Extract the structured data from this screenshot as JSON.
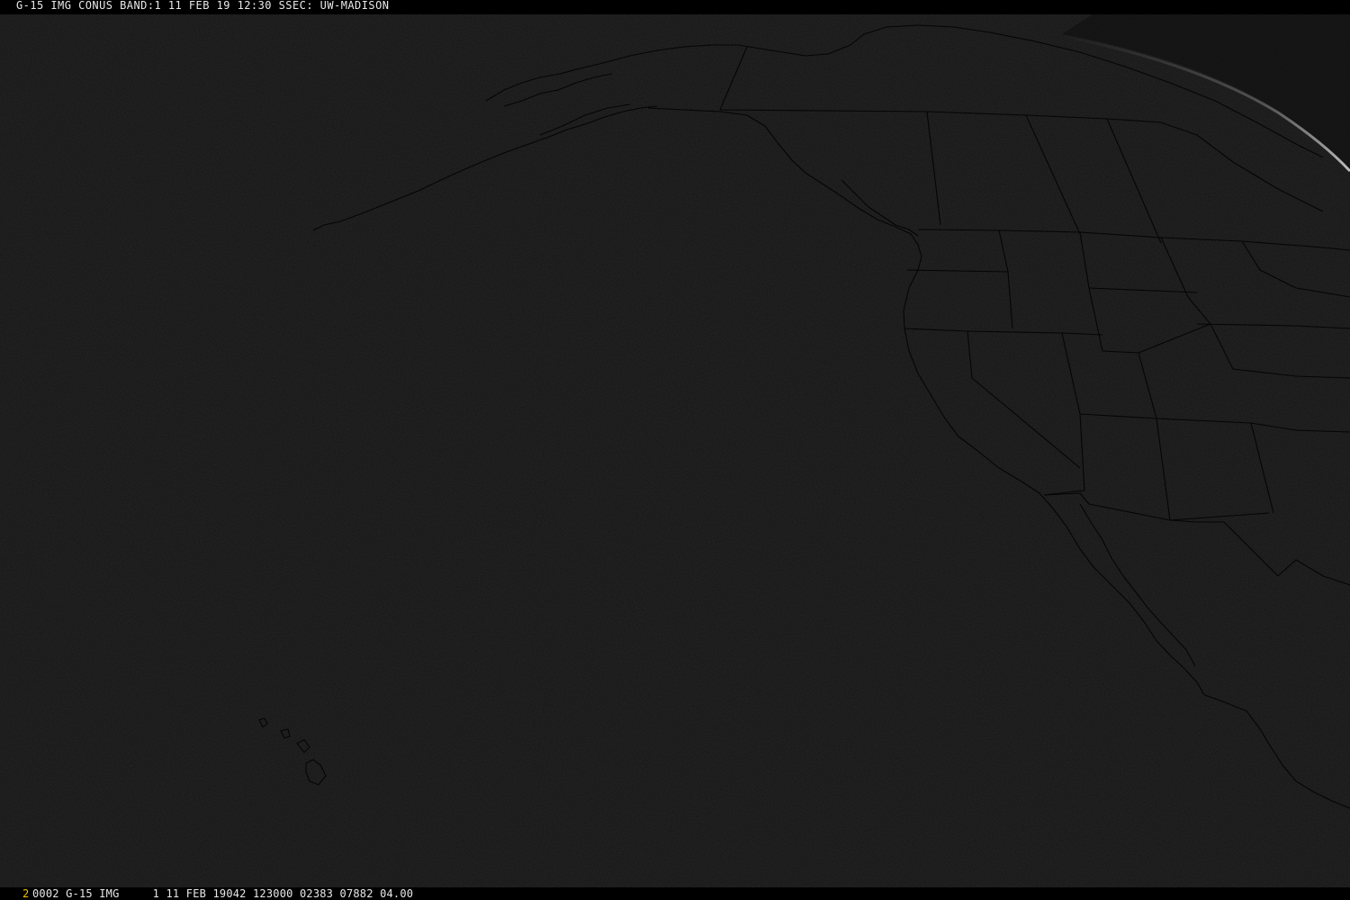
{
  "title_bar": {
    "text": "G-15 IMG CONUS BAND:1 11 FEB 19 12:30 SSEC: UW-MADISON"
  },
  "status_bar": {
    "frame_number": "2",
    "text": "0002 G-15 IMG     1 11 FEB 19042 123000 02383 07882 04.00"
  },
  "colors": {
    "background": "#121212",
    "map_outline": "#060606",
    "limb_glow": "#d8d8d8",
    "frame_number": "#f0c000",
    "text": "#e8e8e8"
  }
}
